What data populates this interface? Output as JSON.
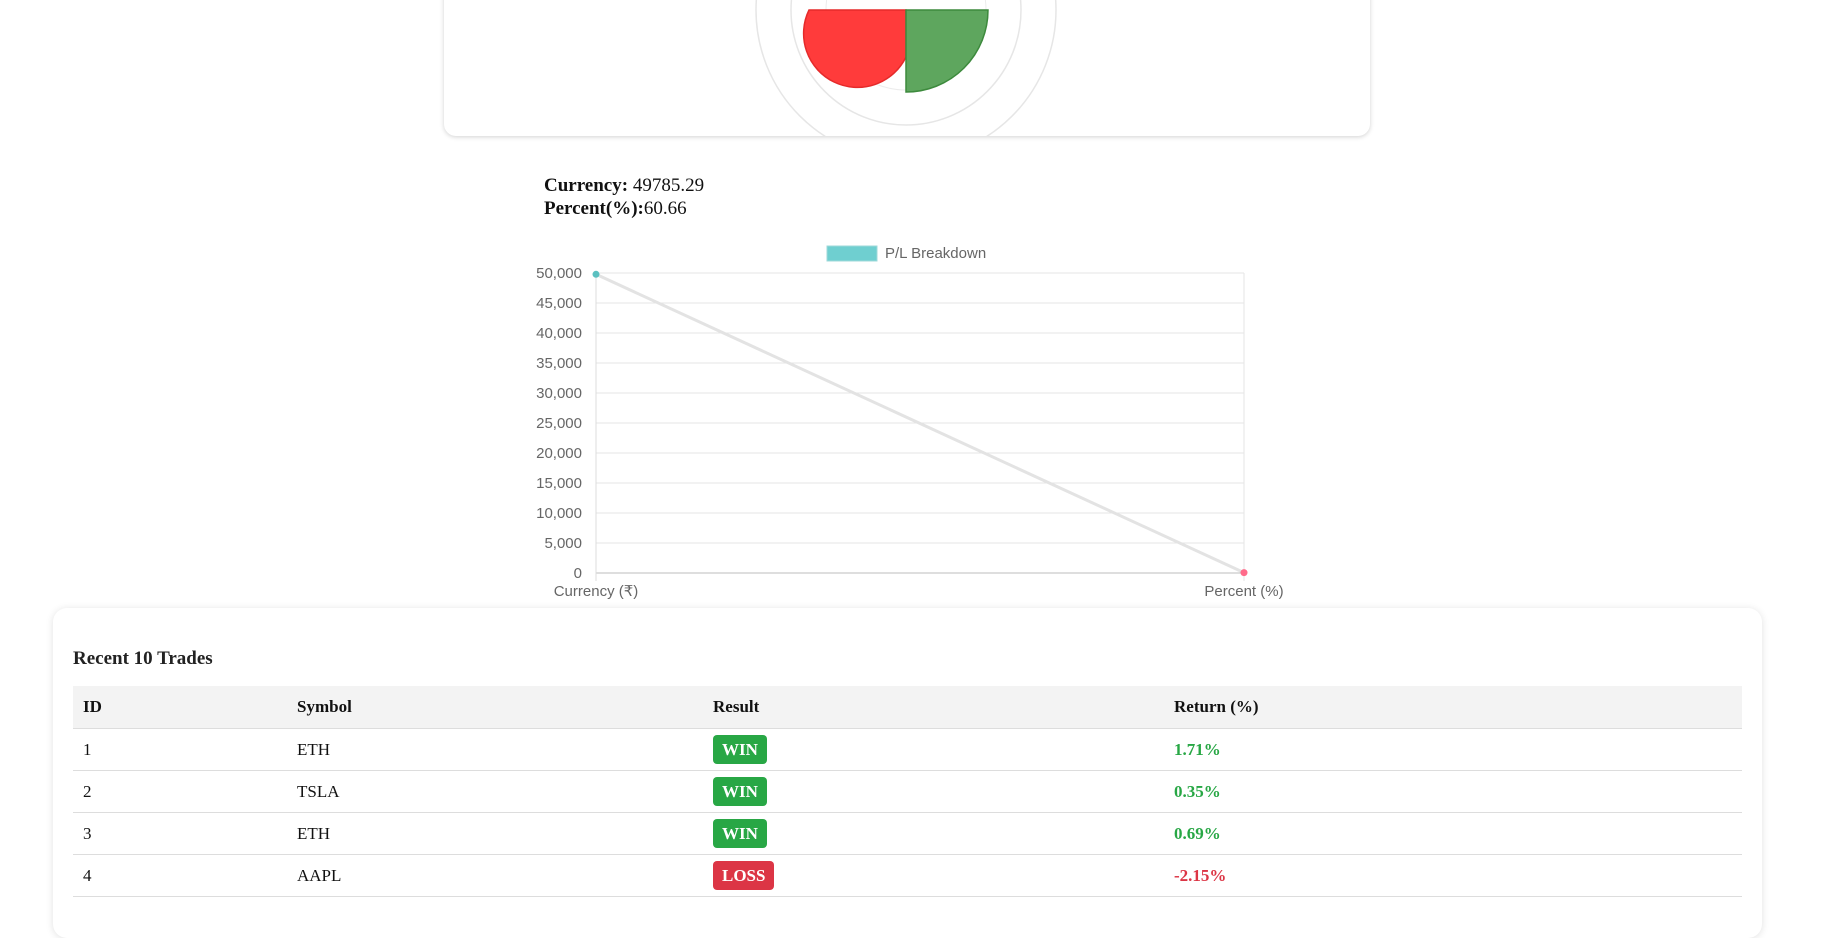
{
  "colors": {
    "win": "#28a745",
    "loss": "#dc3545",
    "polar_red": "#ff3b3b",
    "polar_green": "#5ea65e",
    "line_point_start": "#5bc0c0",
    "line_point_end": "#ff6b8a",
    "legend_box": "#6fcfd0"
  },
  "pl_summary": {
    "currency_label": "Currency:",
    "currency_value": "49785.29",
    "percent_label": "Percent(%):",
    "percent_value": "60.66"
  },
  "chart_data": {
    "type": "line",
    "legend": "P/L Breakdown",
    "legend_placement": "top",
    "categories": [
      "Currency (₹)",
      "Percent (%)"
    ],
    "series": [
      {
        "name": "P/L Breakdown",
        "values": [
          49785.29,
          60.66
        ]
      }
    ],
    "y_ticks": [
      "50,000",
      "45,000",
      "40,000",
      "35,000",
      "30,000",
      "25,000",
      "20,000",
      "15,000",
      "10,000",
      "5,000",
      "0"
    ],
    "ylim": [
      0,
      50000
    ],
    "grid": true
  },
  "trades": {
    "title": "Recent 10 Trades",
    "columns": [
      "ID",
      "Symbol",
      "Result",
      "Return (%)"
    ],
    "rows": [
      {
        "id": "1",
        "symbol": "ETH",
        "result": "WIN",
        "return": "1.71%"
      },
      {
        "id": "2",
        "symbol": "TSLA",
        "result": "WIN",
        "return": "0.35%"
      },
      {
        "id": "3",
        "symbol": "ETH",
        "result": "WIN",
        "return": "0.69%"
      },
      {
        "id": "4",
        "symbol": "AAPL",
        "result": "LOSS",
        "return": "-2.15%"
      }
    ]
  }
}
